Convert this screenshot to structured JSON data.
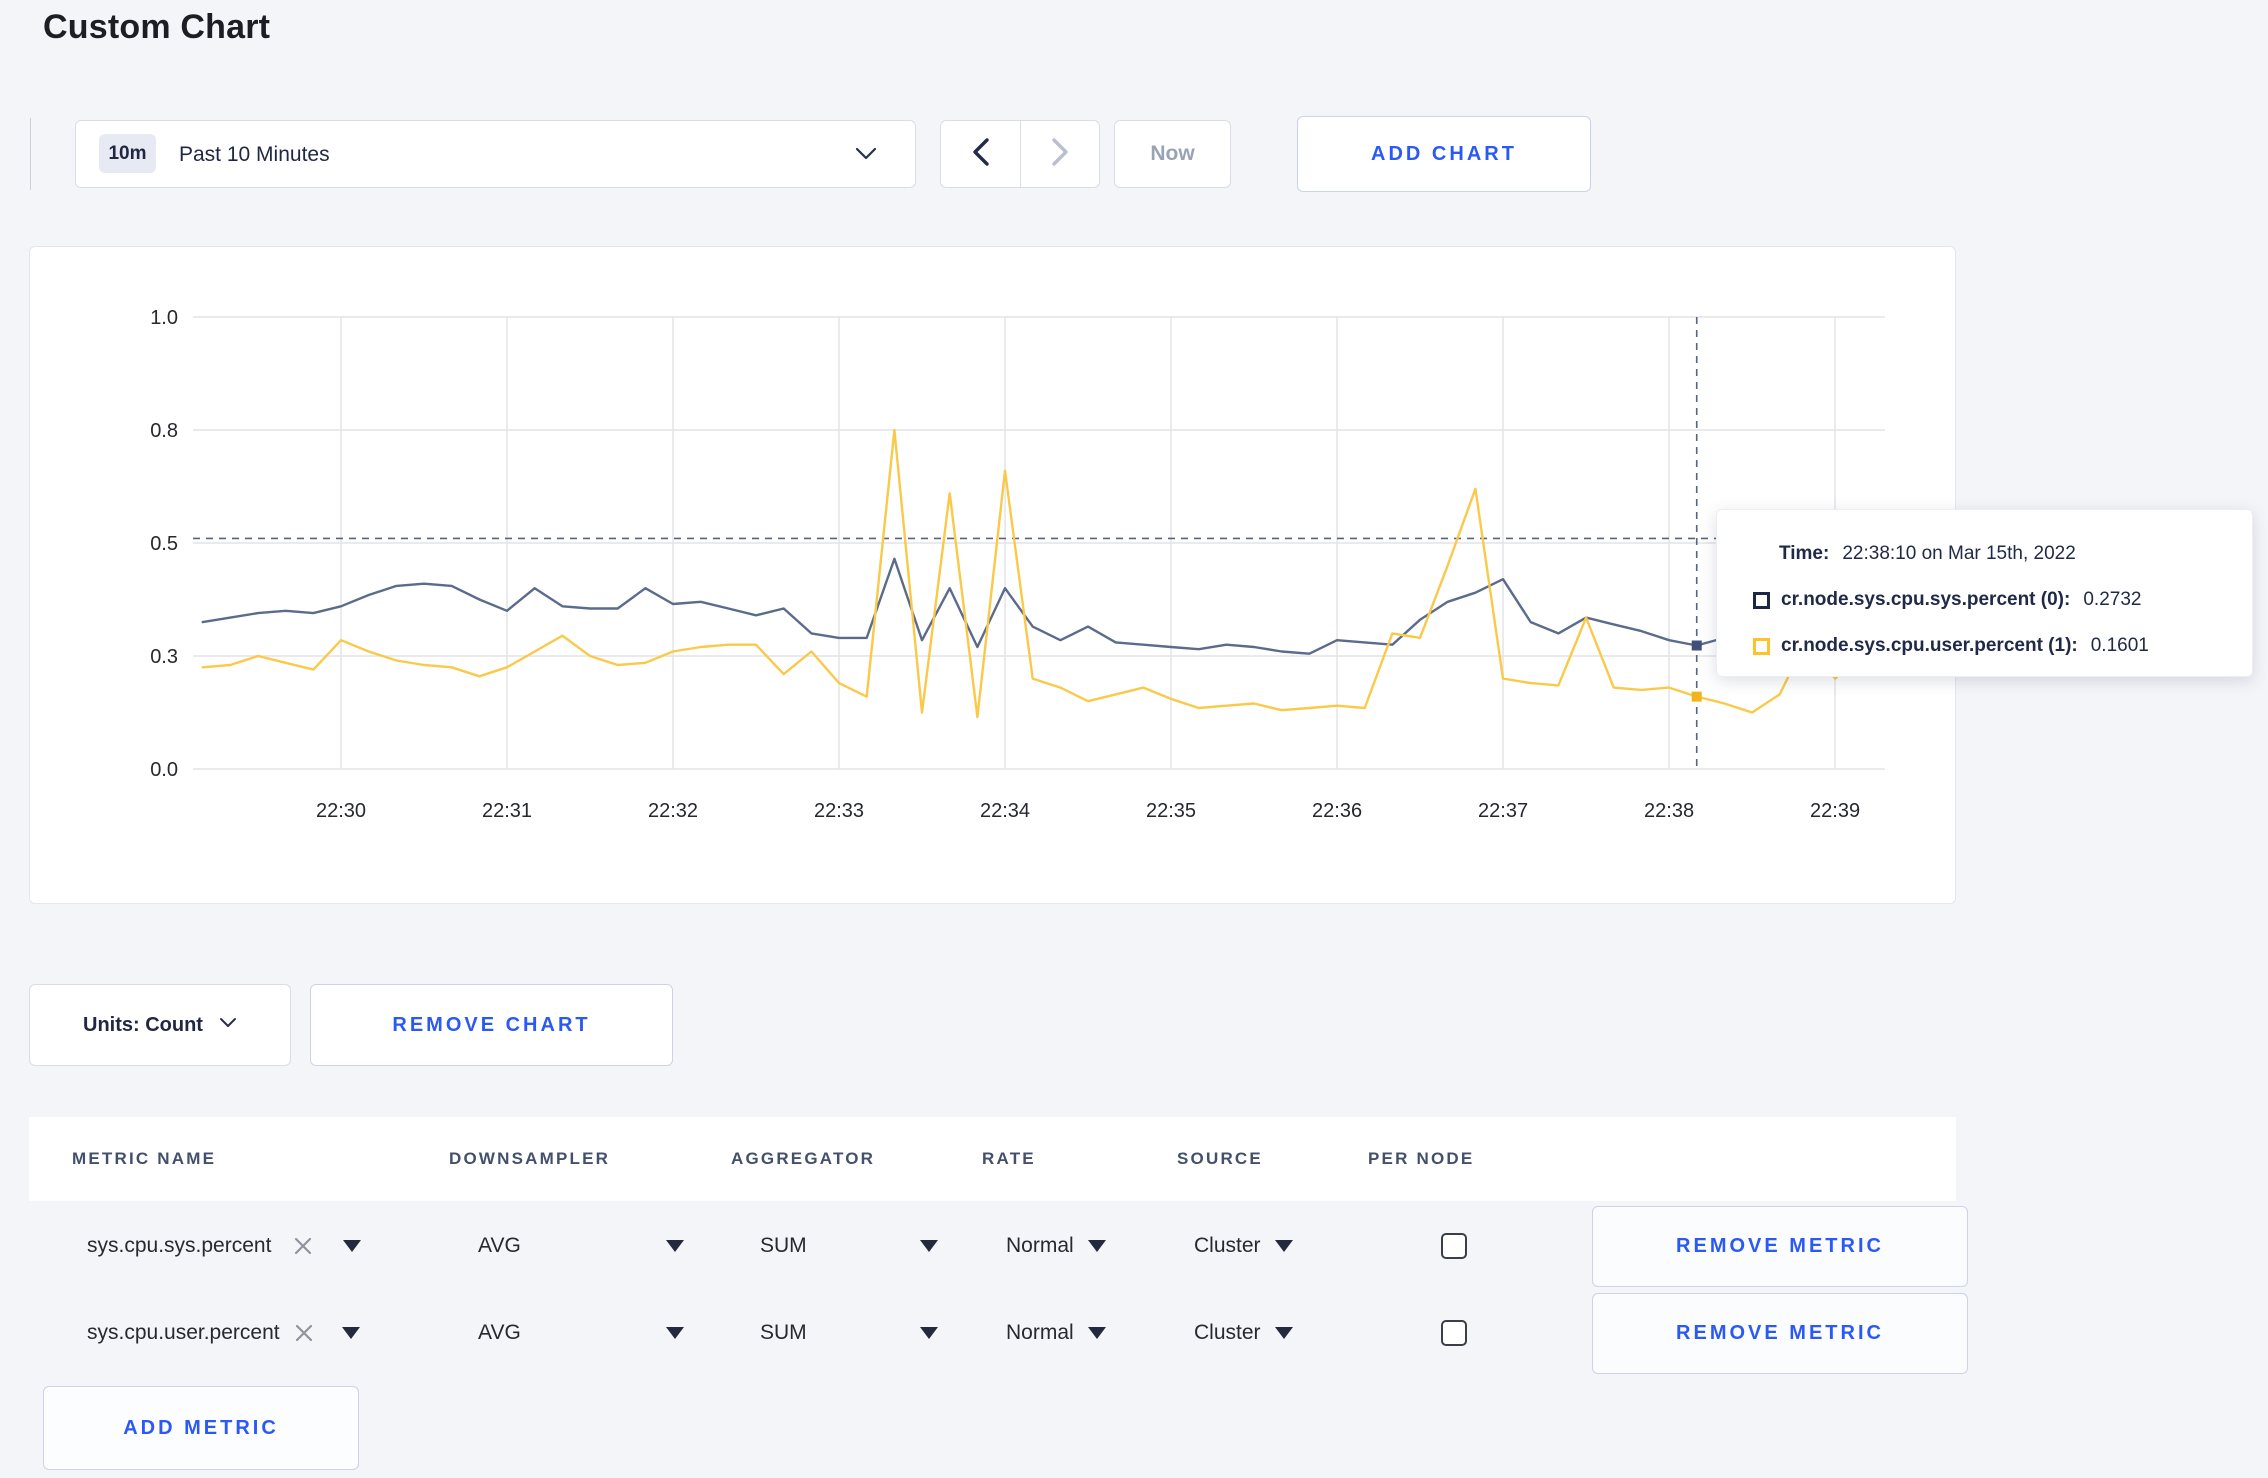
{
  "page": {
    "title": "Custom Chart"
  },
  "toolbar": {
    "timeframe": {
      "badge": "10m",
      "label": "Past 10 Minutes"
    },
    "now_label": "Now",
    "add_chart_label": "ADD CHART"
  },
  "chart_data": {
    "type": "line",
    "title": "",
    "x_start": "22:29:10",
    "x_step_seconds": 10,
    "x_tick_labels": [
      "22:30",
      "22:31",
      "22:32",
      "22:33",
      "22:34",
      "22:35",
      "22:36",
      "22:37",
      "22:38",
      "22:39"
    ],
    "y_ticks": [
      {
        "label": "0.0",
        "value": 0
      },
      {
        "label": "0.3",
        "value": 0.25
      },
      {
        "label": "0.5",
        "value": 0.5
      },
      {
        "label": "0.8",
        "value": 0.75
      },
      {
        "label": "1.0",
        "value": 1.0
      }
    ],
    "ylim": [
      0,
      1
    ],
    "grid": true,
    "legend": "none",
    "hover_guide_value": 0.51,
    "crosshair": {
      "index": 54,
      "time": "22:38:10"
    },
    "series": [
      {
        "name": "cr.node.sys.cpu.sys.percent",
        "color": "#5b6b8b",
        "dot_color": "#41507a",
        "values": [
          0.325,
          0.335,
          0.345,
          0.35,
          0.345,
          0.36,
          0.385,
          0.405,
          0.41,
          0.405,
          0.375,
          0.35,
          0.4,
          0.36,
          0.355,
          0.355,
          0.4,
          0.365,
          0.37,
          0.355,
          0.34,
          0.355,
          0.3,
          0.29,
          0.29,
          0.465,
          0.285,
          0.4,
          0.27,
          0.4,
          0.315,
          0.285,
          0.315,
          0.28,
          0.275,
          0.27,
          0.265,
          0.275,
          0.27,
          0.26,
          0.255,
          0.285,
          0.28,
          0.275,
          0.33,
          0.37,
          0.39,
          0.42,
          0.325,
          0.3,
          0.335,
          0.32,
          0.305,
          0.285,
          0.2732,
          0.29,
          0.295,
          0.285,
          0.28,
          0.285,
          0.315
        ]
      },
      {
        "name": "cr.node.sys.cpu.user.percent",
        "color": "#fbc94a",
        "dot_color": "#f0b41c",
        "values": [
          0.225,
          0.23,
          0.25,
          0.235,
          0.22,
          0.285,
          0.26,
          0.24,
          0.23,
          0.225,
          0.205,
          0.225,
          0.26,
          0.295,
          0.25,
          0.23,
          0.235,
          0.26,
          0.27,
          0.275,
          0.275,
          0.21,
          0.26,
          0.19,
          0.16,
          0.75,
          0.125,
          0.61,
          0.115,
          0.66,
          0.2,
          0.18,
          0.15,
          0.165,
          0.18,
          0.155,
          0.135,
          0.14,
          0.145,
          0.13,
          0.135,
          0.14,
          0.135,
          0.3,
          0.29,
          0.45,
          0.62,
          0.2,
          0.19,
          0.185,
          0.335,
          0.18,
          0.175,
          0.18,
          0.1601,
          0.145,
          0.125,
          0.165,
          0.29,
          0.2,
          0.26
        ]
      }
    ]
  },
  "tooltip": {
    "time_label": "Time:",
    "time_value": "22:38:10 on Mar 15th, 2022",
    "entries": [
      {
        "name": "cr.node.sys.cpu.sys.percent (0):",
        "value": "0.2732",
        "swatch": "#1d2743"
      },
      {
        "name": "cr.node.sys.cpu.user.percent (1):",
        "value": "0.1601",
        "swatch": "#fcc32b"
      }
    ]
  },
  "units": {
    "label": "Units: Count"
  },
  "actions": {
    "remove_chart_label": "REMOVE CHART",
    "add_metric_label": "ADD METRIC"
  },
  "metrics_table": {
    "headers": [
      "METRIC NAME",
      "DOWNSAMPLER",
      "AGGREGATOR",
      "RATE",
      "SOURCE",
      "PER NODE"
    ],
    "rows": [
      {
        "metric": "sys.cpu.sys.percent",
        "downsampler": "AVG",
        "aggregator": "SUM",
        "rate": "Normal",
        "source": "Cluster",
        "per_node_checked": false,
        "remove_label": "REMOVE METRIC"
      },
      {
        "metric": "sys.cpu.user.percent",
        "downsampler": "AVG",
        "aggregator": "SUM",
        "rate": "Normal",
        "source": "Cluster",
        "per_node_checked": false,
        "remove_label": "REMOVE METRIC"
      }
    ]
  },
  "colors": {
    "accent_blue": "#2b59f5",
    "page_background": "#f4f5f9",
    "grid_line": "#e4e4e8",
    "crosshair": "#54657f"
  }
}
